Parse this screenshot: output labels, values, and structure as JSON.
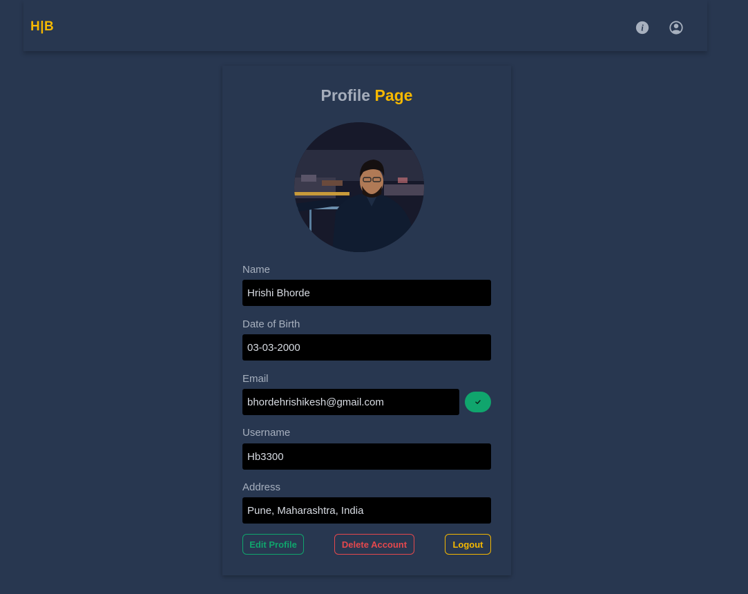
{
  "nav": {
    "logo": "H|B",
    "icons": [
      "info-icon",
      "user-icon"
    ]
  },
  "profile": {
    "title_part1": "Profile",
    "title_part2": "Page",
    "fields": {
      "name": {
        "label": "Name",
        "value": "Hrishi Bhorde"
      },
      "dob": {
        "label": "Date of Birth",
        "value": "03-03-2000"
      },
      "email": {
        "label": "Email",
        "value": "bhordehrishikesh@gmail.com"
      },
      "username": {
        "label": "Username",
        "value": "Hb3300"
      },
      "address": {
        "label": "Address",
        "value": "Pune, Maharashtra, India"
      }
    },
    "buttons": {
      "edit": "Edit Profile",
      "delete": "Delete Account",
      "logout": "Logout"
    }
  },
  "colors": {
    "background": "#283750",
    "accent": "#f5b800",
    "success": "#10a56d",
    "danger": "#e5484d"
  }
}
